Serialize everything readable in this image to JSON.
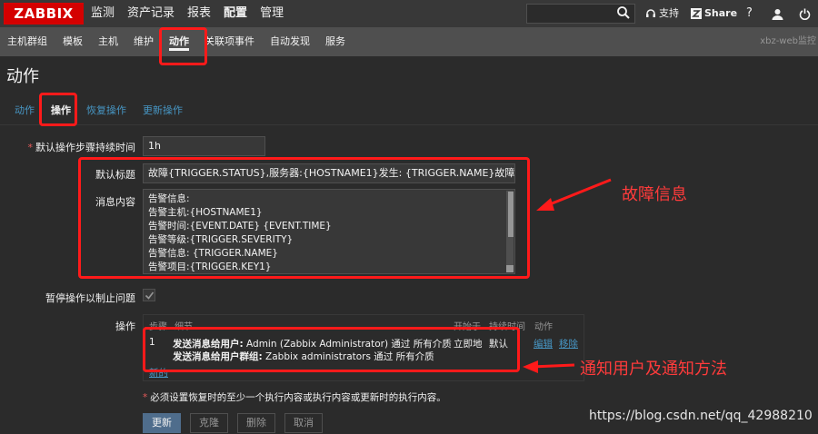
{
  "logo": "ZABBIX",
  "top_menu": [
    "监测",
    "资产记录",
    "报表",
    "配置",
    "管理"
  ],
  "top_menu_active": "配置",
  "search": {
    "value": "",
    "placeholder": ""
  },
  "topbar_right": {
    "support": "支持",
    "share": "Share",
    "help": "?"
  },
  "sub_menu": [
    "主机群组",
    "模板",
    "主机",
    "维护",
    "动作",
    "关联项事件",
    "自动发现",
    "服务"
  ],
  "sub_menu_active": "动作",
  "host_label": "xbz-web监控",
  "page_title": "动作",
  "tabs": [
    "动作",
    "操作",
    "恢复操作",
    "更新操作"
  ],
  "tab_active": "操作",
  "form": {
    "step_duration_label": "默认操作步骤持续时间",
    "step_duration_value": "1h",
    "subject_label": "默认标题",
    "subject_value": "故障{TRIGGER.STATUS},服务器:{HOSTNAME1}发生: {TRIGGER.NAME}故障!",
    "message_label": "消息内容",
    "message_lines": [
      "告警信息:",
      "告警主机:{HOSTNAME1}",
      "告警时间:{EVENT.DATE} {EVENT.TIME}",
      "告警等级:{TRIGGER.SEVERITY}",
      "告警信息: {TRIGGER.NAME}",
      "告警项目:{TRIGGER.KEY1}"
    ],
    "pause_label": "暂停操作以制止问题",
    "pause_checked": true,
    "operations_label": "操作"
  },
  "operations_table": {
    "headers": [
      "步骤",
      "细节",
      "开始于",
      "持续时间",
      "动作"
    ],
    "rows": [
      {
        "step": "1",
        "detail_1_bold": "发送消息给用户:",
        "detail_1_rest": " Admin (Zabbix Administrator) 通过 所有介质",
        "detail_2_bold": "发送消息给用户群组:",
        "detail_2_rest": " Zabbix administrators 通过 所有介质",
        "start": "立即地",
        "duration": "默认",
        "edit": "编辑",
        "remove": "移除"
      }
    ],
    "new_link": "新的"
  },
  "note": "必须设置恢复时的至少一个执行内容或执行内容或更新时的执行内容。",
  "buttons": {
    "update": "更新",
    "clone": "克隆",
    "delete": "删除",
    "cancel": "取消"
  },
  "annotations": {
    "fault_info": "故障信息",
    "notify": "通知用户及通知方法"
  },
  "watermark": "https://blog.csdn.net/qq_42988210",
  "colors": {
    "annotation": "#ff1a1a",
    "link": "#4796c4",
    "logo": "#d40000"
  }
}
